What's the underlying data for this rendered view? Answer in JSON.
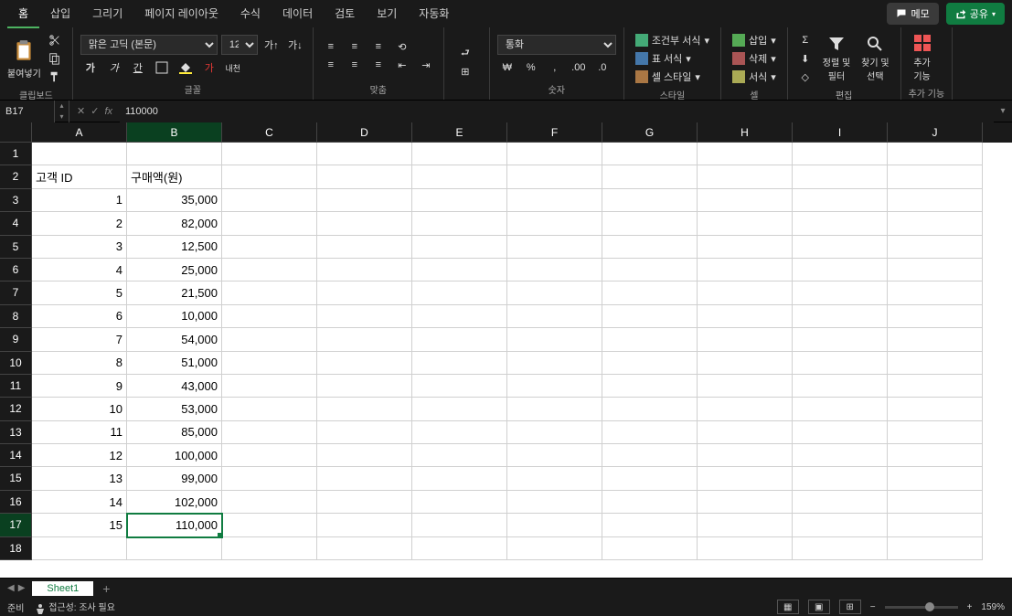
{
  "tabs": {
    "items": [
      "홈",
      "삽입",
      "그리기",
      "페이지 레이아웃",
      "수식",
      "데이터",
      "검토",
      "보기",
      "자동화"
    ],
    "active": 0
  },
  "topRight": {
    "memo": "메모",
    "share": "공유"
  },
  "ribbon": {
    "clipboard": {
      "paste": "붙여넣기",
      "label": "클립보드"
    },
    "font": {
      "name": "맑은 고딕 (본문)",
      "size": "12",
      "bold": "가",
      "italic": "가",
      "underline": "간",
      "ruby": "내천",
      "label": "글꼴"
    },
    "align": {
      "label": "맞춤"
    },
    "number": {
      "format": "통화",
      "label": "숫자"
    },
    "styles": {
      "conditional": "조건부 서식",
      "table": "표 서식",
      "cell": "셀 스타일",
      "label": "스타일"
    },
    "cells": {
      "insert": "삽입",
      "delete": "삭제",
      "format": "서식",
      "label": "셀"
    },
    "editing": {
      "sort": "정렬 및\n필터",
      "find": "찾기 및\n선택",
      "label": "편집"
    },
    "addins": {
      "addins": "추가\n기능",
      "label": "추가 기능"
    }
  },
  "nameBox": "B17",
  "formulaValue": "110000",
  "columns": [
    "A",
    "B",
    "C",
    "D",
    "E",
    "F",
    "G",
    "H",
    "I",
    "J"
  ],
  "activeColumn": 1,
  "rowCount": 18,
  "activeRow": 17,
  "sheetData": {
    "headers": {
      "A": "고객 ID",
      "B": "구매액(원)"
    },
    "rows": [
      {
        "id": "1",
        "amount": "35,000"
      },
      {
        "id": "2",
        "amount": "82,000"
      },
      {
        "id": "3",
        "amount": "12,500"
      },
      {
        "id": "4",
        "amount": "25,000"
      },
      {
        "id": "5",
        "amount": "21,500"
      },
      {
        "id": "6",
        "amount": "10,000"
      },
      {
        "id": "7",
        "amount": "54,000"
      },
      {
        "id": "8",
        "amount": "51,000"
      },
      {
        "id": "9",
        "amount": "43,000"
      },
      {
        "id": "10",
        "amount": "53,000"
      },
      {
        "id": "11",
        "amount": "85,000"
      },
      {
        "id": "12",
        "amount": "100,000"
      },
      {
        "id": "13",
        "amount": "99,000"
      },
      {
        "id": "14",
        "amount": "102,000"
      },
      {
        "id": "15",
        "amount": "110,000"
      }
    ]
  },
  "sheetTab": "Sheet1",
  "statusBar": {
    "ready": "준비",
    "accessibility": "접근성: 조사 필요",
    "zoom": "159%"
  }
}
